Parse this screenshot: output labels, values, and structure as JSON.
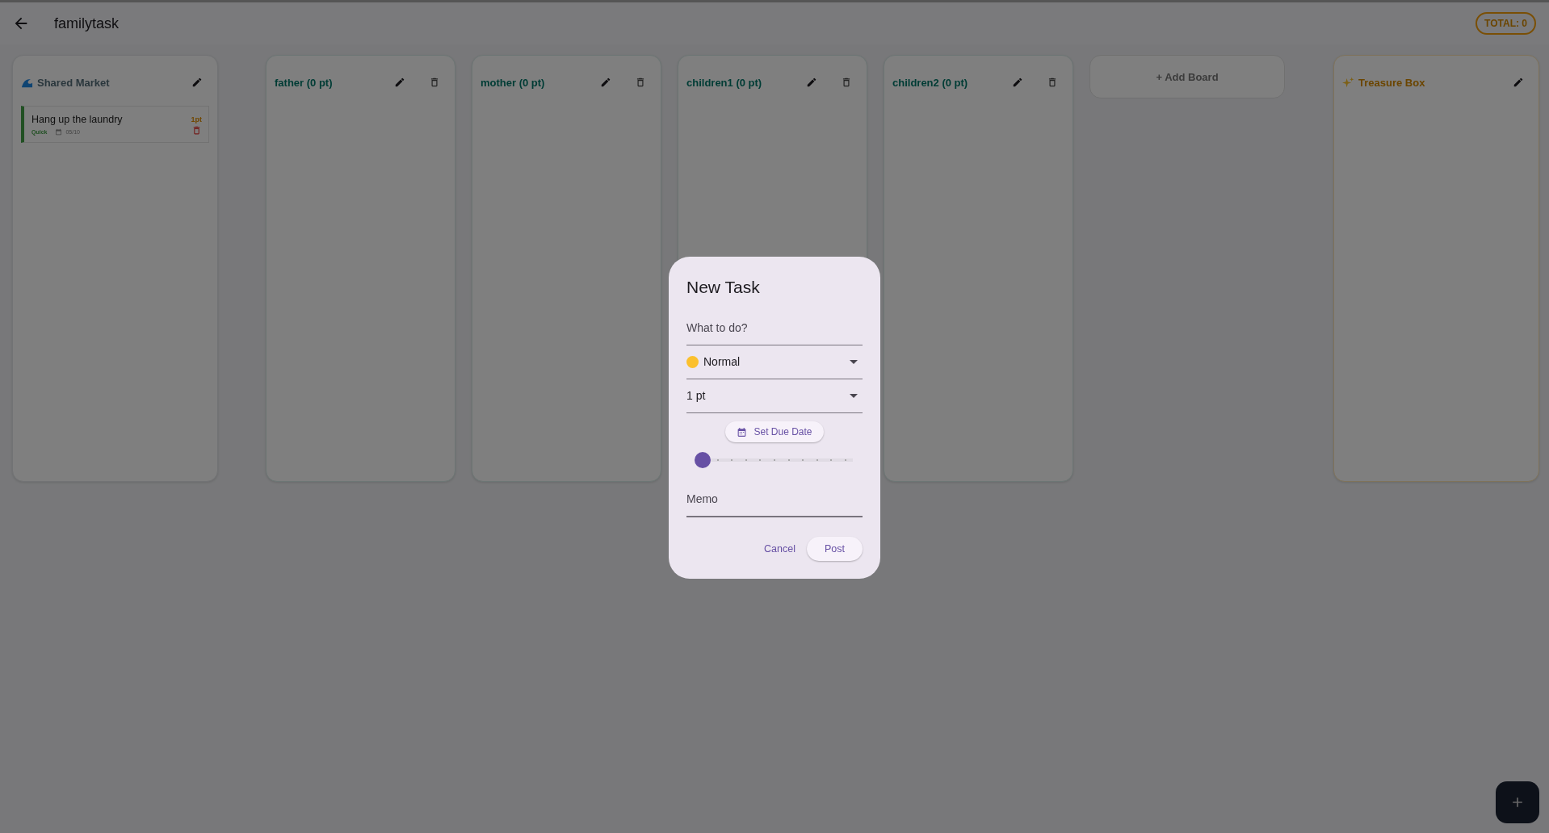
{
  "app_bar": {
    "title": "familytask",
    "total": "TOTAL: 0"
  },
  "boards": [
    {
      "kind": "market",
      "title": "Shared Market",
      "tasks": [
        {
          "title": "Hang up the laundry",
          "points": "1pt",
          "tag": "Quick",
          "due": "05/10"
        }
      ]
    },
    {
      "kind": "member",
      "title": "father (0 pt)"
    },
    {
      "kind": "member",
      "title": "mother (0 pt)"
    },
    {
      "kind": "member",
      "title": "children1 (0 pt)"
    },
    {
      "kind": "member",
      "title": "children2 (0 pt)"
    },
    {
      "kind": "add",
      "title": "+ Add Board"
    },
    {
      "kind": "treasure",
      "title": "Treasure Box"
    }
  ],
  "dialog": {
    "title": "New Task",
    "task_field": {
      "placeholder": "What to do?"
    },
    "priority_select": {
      "value": "Normal"
    },
    "points_select": {
      "value": "1 pt"
    },
    "due_button": "Set Due Date",
    "slider": {
      "level": 0
    },
    "memo_field": {
      "placeholder": "Memo"
    },
    "buttons": [
      "Cancel",
      "Post"
    ]
  }
}
